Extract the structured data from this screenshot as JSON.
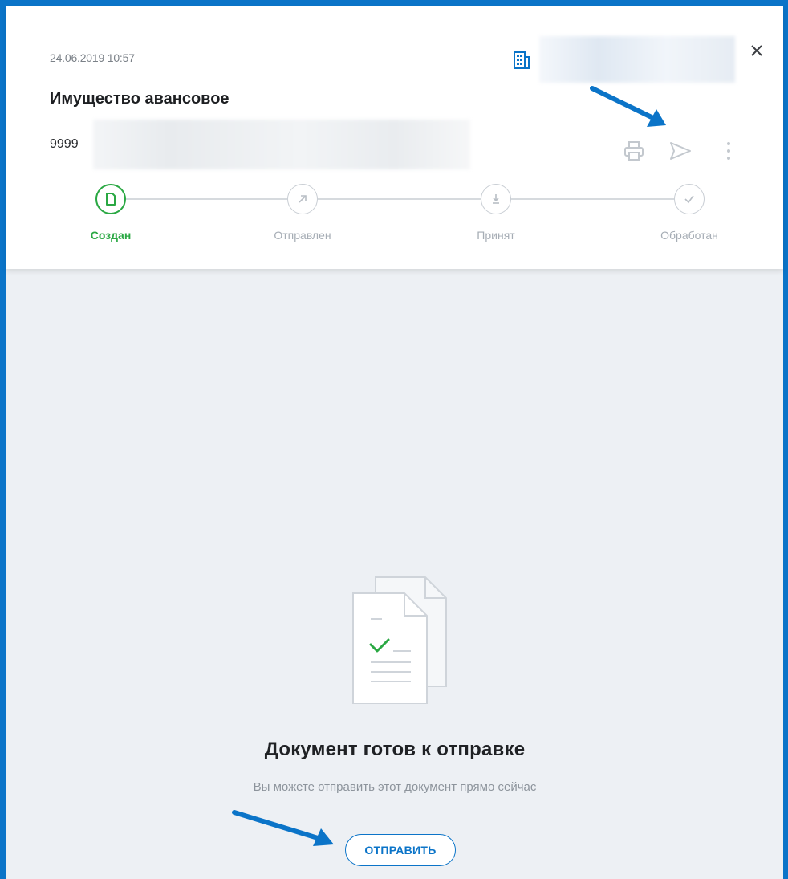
{
  "header": {
    "date": "24.06.2019 10:57",
    "title": "Имущество авансовое",
    "doc_number": "9999"
  },
  "icons": {
    "org": "building-icon",
    "close": "close-icon",
    "print": "printer-icon",
    "send": "send-icon",
    "more": "more-vertical-icon"
  },
  "status_steps": [
    {
      "label": "Создан",
      "icon": "document-icon",
      "state": "active"
    },
    {
      "label": "Отправлен",
      "icon": "arrow-up-right-icon",
      "state": "pending"
    },
    {
      "label": "Принят",
      "icon": "download-icon",
      "state": "pending"
    },
    {
      "label": "Обработан",
      "icon": "check-icon",
      "state": "pending"
    }
  ],
  "empty_state": {
    "title": "Документ готов к отправке",
    "subtitle": "Вы можете отправить этот документ прямо сейчас",
    "button_label": "ОТПРАВИТЬ",
    "illustration": "documents-check-icon"
  },
  "colors": {
    "accent": "#0b74c8",
    "success": "#2aa843",
    "muted": "#a6adb5",
    "content_bg": "#edf0f4"
  }
}
